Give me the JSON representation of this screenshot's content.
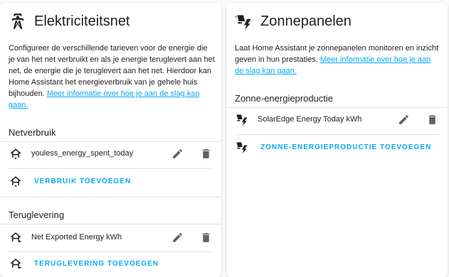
{
  "grid": {
    "title": "Elektriciteitsnet",
    "icon": "transmission-tower-icon",
    "description": "Configureer de verschillende tarieven voor de energie die je van het net verbruikt en als je energie teruglevert aan het net, de energie die je teruglevert aan het net. Hierdoor kan Home Assistant het energieverbruik van je gehele huis bijhouden.",
    "learn_more": "Meer informatie over hoe je aan de slag kan gaan.",
    "consumption": {
      "title": "Netverbruik",
      "icon": "transmission-tower-import-icon",
      "items": [
        {
          "label": "youless_energy_spent_today"
        }
      ],
      "add_label": "VERBRUIK TOEVOEGEN"
    },
    "return": {
      "title": "Teruglevering",
      "icon": "transmission-tower-export-icon",
      "items": [
        {
          "label": "Net Exported Energy kWh"
        }
      ],
      "add_label": "TERUGLEVERING TOEVOEGEN"
    }
  },
  "solar": {
    "title": "Zonnepanelen",
    "icon": "solar-power-icon",
    "description": "Laat Home Assistant je zonnepanelen monitoren en inzicht geven in hun prestaties.",
    "learn_more": "Meer informatie over hoe je aan de slag kan gaan.",
    "production": {
      "title": "Zonne-energieproductie",
      "items": [
        {
          "label": "SolarEdge Energy Today kWh"
        }
      ],
      "add_label": "ZONNE-ENERGIEPRODUCTIE TOEVOEGEN"
    }
  },
  "colors": {
    "accent": "#03a9f4",
    "icon": "#212121",
    "action_icon": "#616161",
    "divider": "#e0e0e0"
  }
}
